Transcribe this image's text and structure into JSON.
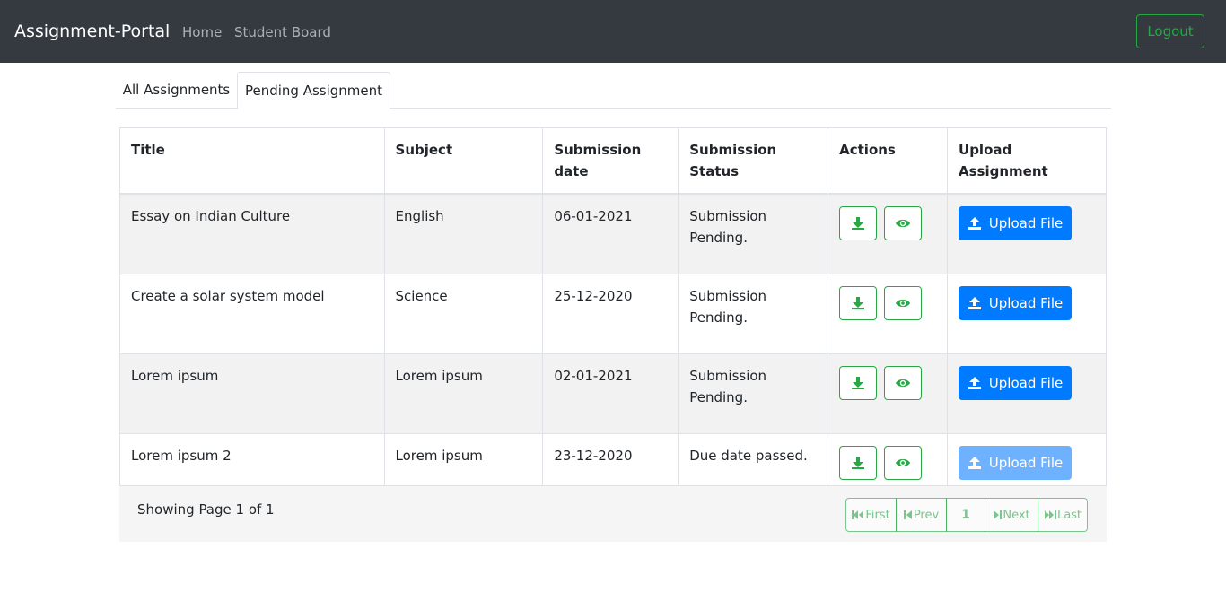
{
  "navbar": {
    "brand": "Assignment-Portal",
    "links": [
      "Home",
      "Student Board"
    ],
    "logout": "Logout"
  },
  "tabs": [
    "All Assignments",
    "Pending Assignment"
  ],
  "table": {
    "headers": [
      "Title",
      "Subject",
      "Submission date",
      "Submission Status",
      "Actions",
      "Upload Assignment"
    ],
    "rows": [
      {
        "title": "Essay on Indian Culture",
        "subject": "English",
        "date": "06-01-2021",
        "status": "Submission Pending.",
        "upload": "Upload File",
        "upload_enabled": true
      },
      {
        "title": "Create a solar system model",
        "subject": "Science",
        "date": "25-12-2020",
        "status": "Submission Pending.",
        "upload": "Upload File",
        "upload_enabled": true
      },
      {
        "title": "Lorem ipsum",
        "subject": "Lorem ipsum",
        "date": "02-01-2021",
        "status": "Submission Pending.",
        "upload": "Upload File",
        "upload_enabled": true
      },
      {
        "title": "Lorem ipsum 2",
        "subject": "Lorem ipsum",
        "date": "23-12-2020",
        "status": "Due date passed.",
        "upload": "Upload File",
        "upload_enabled": false
      }
    ]
  },
  "pagination": {
    "info": "Showing Page 1 of 1",
    "first": "First",
    "prev": "Prev",
    "current": "1",
    "next": "Next",
    "last": "Last"
  },
  "colors": {
    "navbar": "#343a40",
    "success": "#28a745",
    "primary": "#007bff"
  },
  "icons": {
    "download": "download-icon",
    "view": "eye-icon",
    "upload": "upload-icon"
  }
}
